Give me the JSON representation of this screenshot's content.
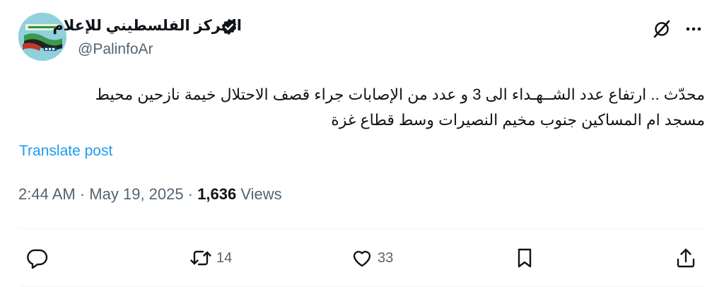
{
  "author": {
    "display_name": "المركز الفلسطيني للإعلام",
    "handle": "@PalinfoAr",
    "verified_icon": "verified-badge-icon",
    "avatar_icon": "palinfo-logo"
  },
  "header_icons": [
    "grok-icon",
    "more-icon"
  ],
  "tweet": {
    "lines": [
      "محدّث ..  ارتفاع عدد الشــهـداء الى 3 و عدد من الإصابات جراء قصف الاحتلال خيمة نازحين محيط",
      "مسجد ام المساكين جنوب مخيم النصيرات وسط قطاع غزة"
    ],
    "translate_label": "Translate post"
  },
  "meta": {
    "time": "2:44 AM",
    "separator": "·",
    "date": "May 19, 2025",
    "views_count": "1,636",
    "views_label": "Views"
  },
  "actions": {
    "reply": {
      "icon": "reply-icon",
      "count": ""
    },
    "retweet": {
      "icon": "retweet-icon",
      "count": "14"
    },
    "like": {
      "icon": "heart-icon",
      "count": "33"
    },
    "bookmark": {
      "icon": "bookmark-icon",
      "count": ""
    },
    "share": {
      "icon": "share-icon",
      "count": ""
    }
  },
  "colors": {
    "text": "#0f1419",
    "secondary": "#536471",
    "link": "#1d9bf0",
    "divider": "#eff3f4"
  }
}
